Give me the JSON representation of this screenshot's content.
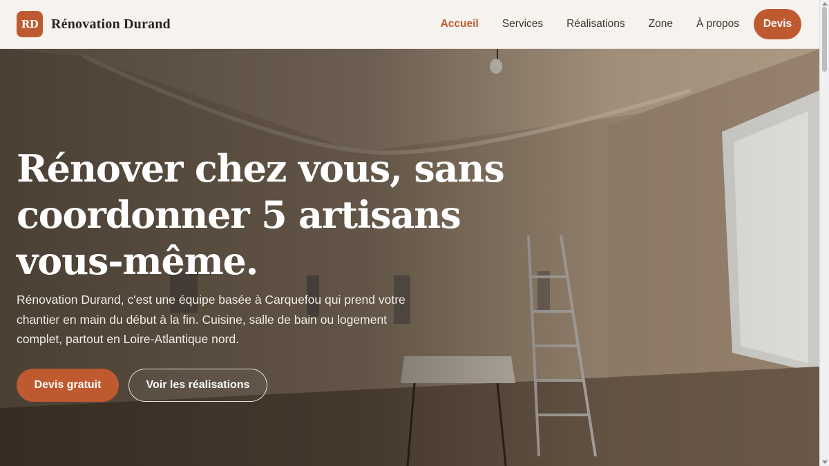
{
  "brand": {
    "logo_text": "RD",
    "name": "Rénovation Durand"
  },
  "nav": {
    "items": [
      {
        "label": "Accueil",
        "active": true
      },
      {
        "label": "Services",
        "active": false
      },
      {
        "label": "Réalisations",
        "active": false
      },
      {
        "label": "Zone",
        "active": false
      },
      {
        "label": "À propos",
        "active": false
      }
    ],
    "cta_label": "Devis"
  },
  "hero": {
    "title": "Rénover chez vous, sans coordonner 5 artisans vous-même.",
    "text": "Rénovation Durand, c'est une équipe basée à Carquefou qui prend votre chantier en main du début à la fin. Cuisine, salle de bain ou logement complet, partout en Loire-Atlantique nord.",
    "primary_cta": "Devis gratuit",
    "secondary_cta": "Voir les réalisations"
  },
  "colors": {
    "accent": "#bf5a30",
    "nav_bg": "#f6f3ee",
    "text_dark": "#2a2520"
  }
}
